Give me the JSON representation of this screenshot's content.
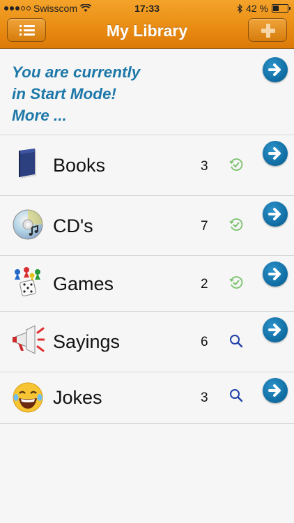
{
  "status_bar": {
    "carrier": "Swisscom",
    "time": "17:33",
    "battery": "42 %"
  },
  "nav": {
    "title": "My Library"
  },
  "banner": {
    "line1": "You are currently",
    "line2": "in Start Mode!",
    "line3": "More ..."
  },
  "items": [
    {
      "label": "Books",
      "count": "3",
      "status_icon": "check-sync-icon",
      "icon": "book-icon"
    },
    {
      "label": "CD's",
      "count": "7",
      "status_icon": "check-sync-icon",
      "icon": "cd-icon"
    },
    {
      "label": "Games",
      "count": "2",
      "status_icon": "check-sync-icon",
      "icon": "board-game-icon"
    },
    {
      "label": "Sayings",
      "count": "6",
      "status_icon": "search-icon",
      "icon": "megaphone-icon"
    },
    {
      "label": "Jokes",
      "count": "3",
      "status_icon": "search-icon",
      "icon": "laughing-emoji-icon"
    }
  ],
  "colors": {
    "nav_orange": "#e98b12",
    "banner_text": "#1e78a8",
    "arrow_blue": "#0f6aa0",
    "check_green": "#7cc26f",
    "search_blue": "#1f3fa8"
  }
}
